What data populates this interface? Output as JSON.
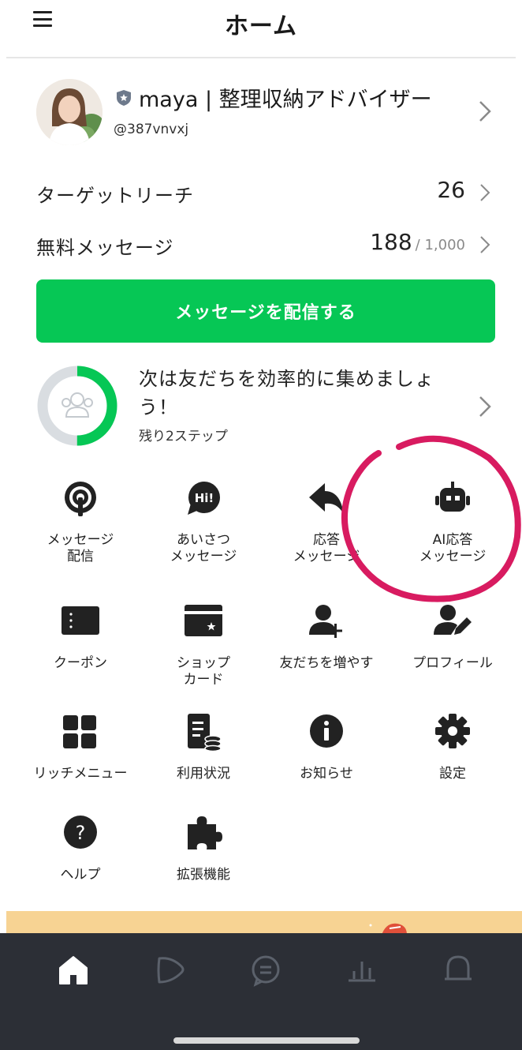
{
  "header": {
    "title": "ホーム",
    "menu_icon": "hamburger-icon"
  },
  "account": {
    "name": "maya | 整理収納アドバイザー",
    "id": "@387vnvxj",
    "badge_icon": "shield-icon"
  },
  "stats": {
    "target_reach_label": "ターゲットリーチ",
    "target_reach_value": "26",
    "free_messages_label": "無料メッセージ",
    "free_messages_value": "188",
    "free_messages_total": "/ 1,000"
  },
  "send_button_label": "メッセージを配信する",
  "progress": {
    "title": "次は友だちを効率的に集めましょう！",
    "subtitle": "残り2ステップ",
    "completion_fraction": 0.5
  },
  "menu_grid": [
    {
      "label": "メッセージ\n配信",
      "icon": "broadcast-icon"
    },
    {
      "label": "あいさつ\nメッセージ",
      "icon": "hi-bubble-icon"
    },
    {
      "label": "応答\nメッセージ",
      "icon": "reply-arrow-icon"
    },
    {
      "label": "AI応答\nメッセージ",
      "icon": "robot-icon"
    },
    {
      "label": "クーポン",
      "icon": "coupon-icon"
    },
    {
      "label": "ショップ\nカード",
      "icon": "shop-card-icon"
    },
    {
      "label": "友だちを増やす",
      "icon": "add-friend-icon"
    },
    {
      "label": "プロフィール",
      "icon": "profile-edit-icon"
    },
    {
      "label": "リッチメニュー",
      "icon": "rich-menu-icon"
    },
    {
      "label": "利用状況",
      "icon": "usage-icon"
    },
    {
      "label": "お知らせ",
      "icon": "info-icon"
    },
    {
      "label": "設定",
      "icon": "gear-icon"
    },
    {
      "label": "ヘルプ",
      "icon": "help-icon"
    },
    {
      "label": "拡張機能",
      "icon": "puzzle-icon"
    }
  ],
  "tabbar": [
    "home-icon",
    "voom-icon",
    "chat-icon",
    "analytics-icon",
    "notification-icon"
  ],
  "colors": {
    "accent": "#06c755",
    "annotation": "#d81b60",
    "tabbar": "#2c2f36",
    "banner": "#f7d393"
  }
}
